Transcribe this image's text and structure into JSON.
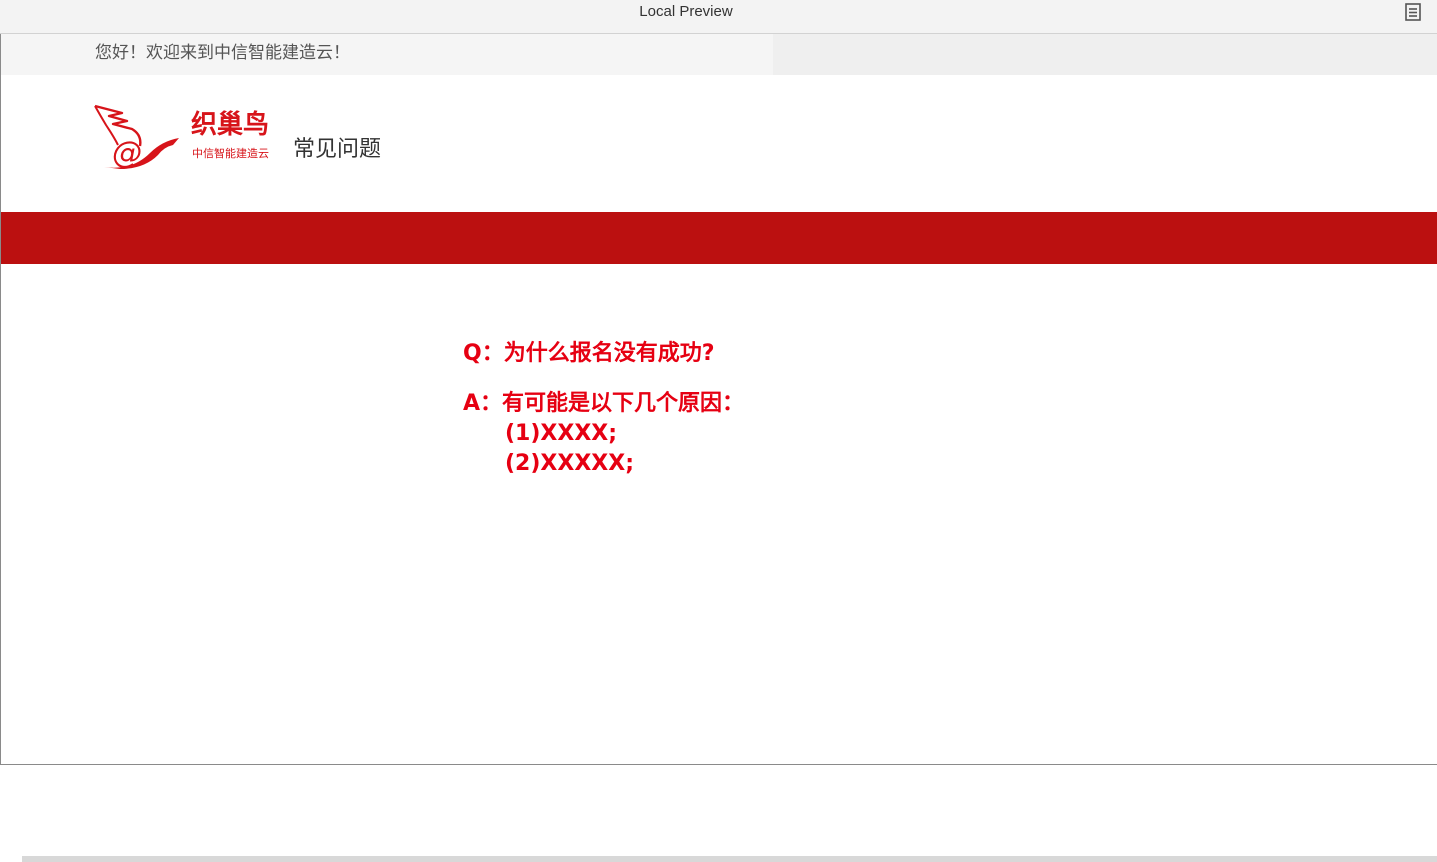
{
  "window": {
    "title": "Local Preview",
    "menu_icon": "list-icon"
  },
  "welcome": {
    "text": "您好！欢迎来到中信智能建造云！"
  },
  "brand": {
    "name": "织巢鸟",
    "tagline": "中信智能建造云",
    "logo_icon": "bird-at-logo",
    "section_title": "常见问题"
  },
  "faq": {
    "question": "Q：为什么报名没有成功?",
    "answer_intro": "A：有可能是以下几个原因：",
    "reasons": [
      "(1)XXXX;",
      "(2)XXXXX;"
    ]
  },
  "colors": {
    "banner_red": "#bb1010",
    "brand_red": "#d7141a",
    "faq_red": "#e60012"
  }
}
